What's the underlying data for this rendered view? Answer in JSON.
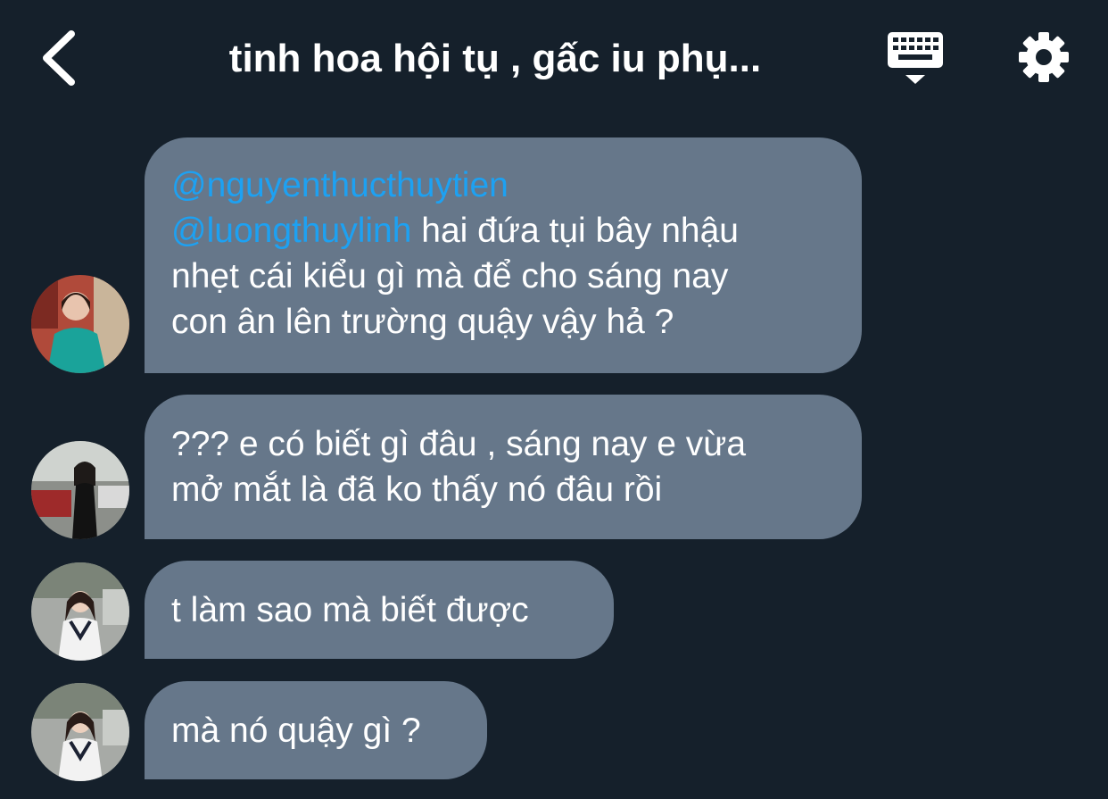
{
  "header": {
    "title": "tinh hoa hội tụ , gấc iu phụ...",
    "back_icon": "chevron-left-icon",
    "keyboard_icon": "keyboard-icon",
    "settings_icon": "gear-icon"
  },
  "colors": {
    "background": "#15202b",
    "bubble": "#66778a",
    "mention": "#1da1f2",
    "text": "#ffffff"
  },
  "messages": [
    {
      "mention1": "@nguyenthucthuytien",
      "mention2": "@luongthuylinh",
      "line2_text": " hai đứa tụi bây nhậu",
      "line3": "nhẹt cái kiểu gì mà để cho sáng nay",
      "line4": "con ân lên trường quậy vậy hả ?"
    },
    {
      "line1": "??? e có biết gì đâu , sáng nay e vừa",
      "line2": "mở mắt là đã ko thấy nó đâu rồi"
    },
    {
      "line1": "t làm sao mà biết được"
    },
    {
      "line1": "mà nó quậy gì ?"
    }
  ]
}
